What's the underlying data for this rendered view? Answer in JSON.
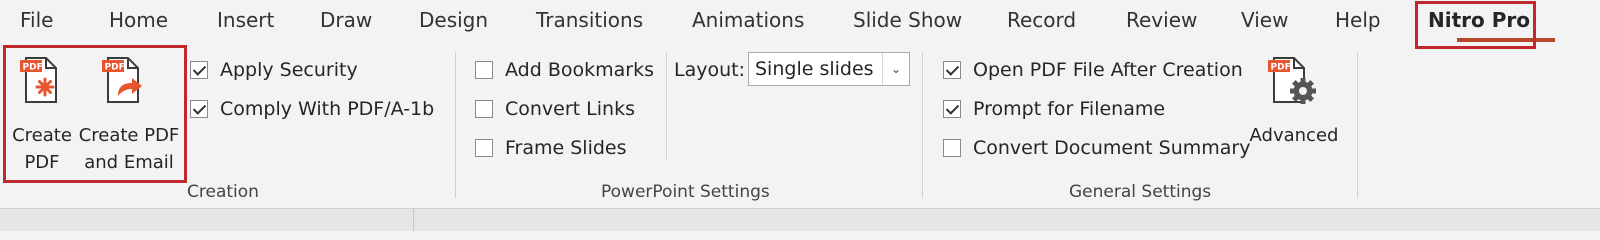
{
  "tabs": [
    {
      "id": "file",
      "label": "File"
    },
    {
      "id": "home",
      "label": "Home"
    },
    {
      "id": "insert",
      "label": "Insert"
    },
    {
      "id": "draw",
      "label": "Draw"
    },
    {
      "id": "design",
      "label": "Design"
    },
    {
      "id": "transitions",
      "label": "Transitions"
    },
    {
      "id": "animations",
      "label": "Animations"
    },
    {
      "id": "slideshow",
      "label": "Slide Show"
    },
    {
      "id": "record",
      "label": "Record"
    },
    {
      "id": "review",
      "label": "Review"
    },
    {
      "id": "view",
      "label": "View"
    },
    {
      "id": "help",
      "label": "Help"
    },
    {
      "id": "nitro",
      "label": "Nitro Pro",
      "active": true
    }
  ],
  "creation": {
    "create_pdf": {
      "line1": "Create",
      "line2": "PDF",
      "icon": "pdf-create-icon",
      "badge": "PDF"
    },
    "create_pdf_email": {
      "line1": "Create PDF",
      "line2": "and Email",
      "icon": "pdf-email-icon",
      "badge": "PDF"
    },
    "apply_security": {
      "label": "Apply Security",
      "checked": true
    },
    "comply_pdfa": {
      "label": "Comply With PDF/A-1b",
      "checked": true
    },
    "group_label": "Creation"
  },
  "powerpoint": {
    "add_bookmarks": {
      "label": "Add Bookmarks",
      "checked": false
    },
    "convert_links": {
      "label": "Convert Links",
      "checked": false
    },
    "frame_slides": {
      "label": "Frame Slides",
      "checked": false
    },
    "layout_label": "Layout:",
    "layout_value": "Single slides",
    "group_label": "PowerPoint Settings"
  },
  "general": {
    "open_pdf": {
      "label": "Open PDF File After Creation",
      "checked": true
    },
    "prompt_filename": {
      "label": "Prompt for Filename",
      "checked": true
    },
    "convert_summary": {
      "label": "Convert Document Summary",
      "checked": false
    },
    "advanced": {
      "label": "Advanced",
      "icon": "pdf-settings-icon",
      "badge": "PDF"
    },
    "group_label": "General Settings"
  },
  "colors": {
    "accent": "#b7472a",
    "highlight": "#c0282d",
    "pdf_red": "#e8542e"
  }
}
